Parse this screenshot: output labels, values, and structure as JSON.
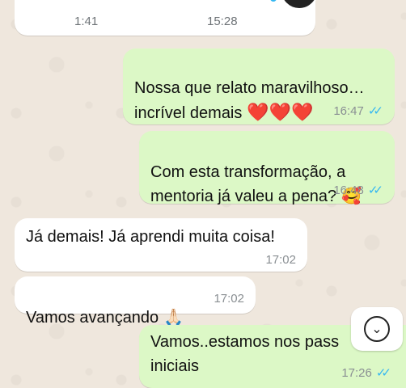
{
  "voice_message": {
    "duration": "1:41",
    "time": "15:28"
  },
  "messages": [
    {
      "direction": "out",
      "text": "Nossa que relato maravilhoso…\nincrível demais",
      "emoji": "❤️❤️❤️",
      "time": "16:47"
    },
    {
      "direction": "out",
      "text": "Com esta transformação, a\nmentoria já valeu a pena?",
      "emoji": "🥰",
      "time": "16:48"
    },
    {
      "direction": "in",
      "text": "Já demais! Já aprendi muita coisa!",
      "time": "17:02"
    },
    {
      "direction": "in",
      "text": "Vamos avançando",
      "emoji": "🙏🏻",
      "time": "17:02"
    },
    {
      "direction": "out",
      "text": "Vamos..estamos nos pass\niniciais",
      "time": "17:26"
    }
  ],
  "read_receipt": "✓✓",
  "icons": {
    "scroll_down": "chevron-down-circle-icon",
    "mic": "microphone-icon",
    "play": "play-icon"
  },
  "colors": {
    "incoming": "#ffffff",
    "outgoing": "#dcf8c6",
    "read_ticks": "#34b7f1",
    "background": "#efe7dd"
  }
}
